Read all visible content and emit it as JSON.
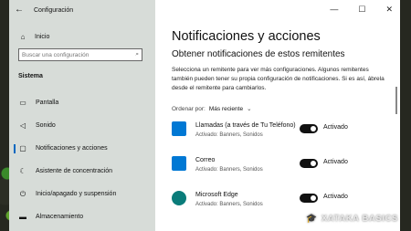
{
  "window": {
    "title": "Configuración",
    "controls": {
      "minimize": "—",
      "maximize": "☐",
      "close": "✕"
    }
  },
  "sidebar": {
    "home_label": "Inicio",
    "search": {
      "placeholder": "Buscar una configuración"
    },
    "section_label": "Sistema",
    "items": [
      {
        "label": "Pantalla",
        "icon": "monitor-icon"
      },
      {
        "label": "Sonido",
        "icon": "speaker-icon"
      },
      {
        "label": "Notificaciones y acciones",
        "icon": "notifications-icon"
      },
      {
        "label": "Asistente de concentración",
        "icon": "moon-icon"
      },
      {
        "label": "Inicio/apagado y suspensión",
        "icon": "power-icon"
      },
      {
        "label": "Almacenamiento",
        "icon": "storage-icon"
      }
    ]
  },
  "main": {
    "title": "Notificaciones y acciones",
    "subtitle": "Obtener notificaciones de estos remitentes",
    "description": "Selecciona un remitente para ver más configuraciones. Algunos remitentes también pueden tener su propia configuración de notificaciones. Si es así, ábrela desde el remitente para cambiarlos.",
    "sort_label": "Ordenar por:",
    "sort_value": "Más reciente",
    "apps": [
      {
        "name": "Llamadas (a través de Tu Teléfono)",
        "status": "Activado: Banners, Sonidos",
        "toggle_label": "Activado",
        "color": "#0078d4"
      },
      {
        "name": "Correo",
        "status": "Activado: Banners, Sonidos",
        "toggle_label": "Activado",
        "color": "#0078d4"
      },
      {
        "name": "Microsoft Edge",
        "status": "Activado: Banners, Sonidos",
        "toggle_label": "Activado",
        "color": "#0a7c7a"
      }
    ]
  },
  "watermark": "XATAKA BASICS"
}
